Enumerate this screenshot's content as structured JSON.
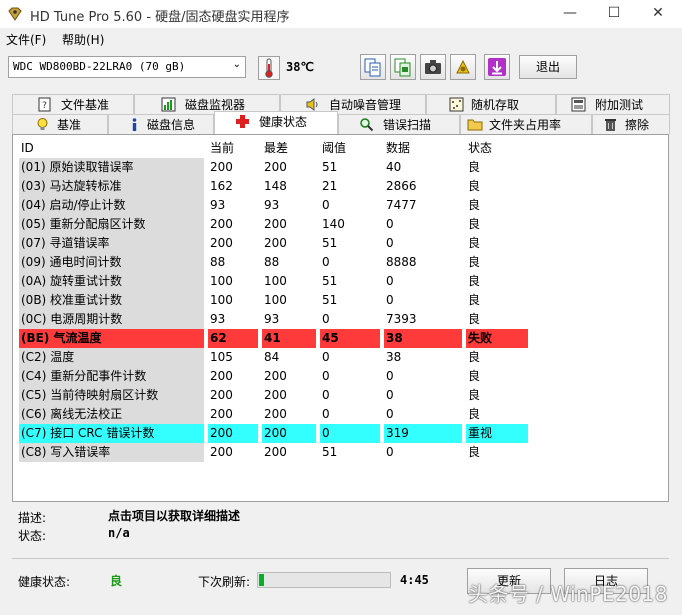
{
  "window": {
    "title": "HD Tune Pro 5.60 - 硬盘/固态硬盘实用程序",
    "minimize": "—",
    "maximize": "☐",
    "close": "✕"
  },
  "menu": {
    "file": "文件(F)",
    "help": "帮助(H)"
  },
  "toolbar": {
    "drive": "WDC WD800BD-22LRA0 (70 gB)",
    "temperature": "38℃",
    "exit": "退出",
    "buttons": [
      "copy-text-icon",
      "copy-screen-icon",
      "camera-icon",
      "options-icon",
      "save-icon"
    ]
  },
  "tabs": {
    "row1": [
      "文件基准",
      "磁盘监视器",
      "自动噪音管理",
      "随机存取",
      "附加测试"
    ],
    "row2": [
      "基准",
      "磁盘信息",
      "健康状态",
      "错误扫描",
      "文件夹占用率",
      "擦除"
    ],
    "active": "健康状态"
  },
  "table": {
    "columns": [
      "ID",
      "当前",
      "最差",
      "阈值",
      "数据",
      "状态"
    ],
    "rows": [
      {
        "id": "(01) 原始读取错误率",
        "current": "200",
        "worst": "200",
        "threshold": "51",
        "data": "40",
        "status": "良",
        "highlight": ""
      },
      {
        "id": "(03) 马达旋转标准",
        "current": "162",
        "worst": "148",
        "threshold": "21",
        "data": "2866",
        "status": "良",
        "highlight": ""
      },
      {
        "id": "(04) 启动/停止计数",
        "current": "93",
        "worst": "93",
        "threshold": "0",
        "data": "7477",
        "status": "良",
        "highlight": ""
      },
      {
        "id": "(05) 重新分配扇区计数",
        "current": "200",
        "worst": "200",
        "threshold": "140",
        "data": "0",
        "status": "良",
        "highlight": ""
      },
      {
        "id": "(07) 寻道错误率",
        "current": "200",
        "worst": "200",
        "threshold": "51",
        "data": "0",
        "status": "良",
        "highlight": ""
      },
      {
        "id": "(09) 通电时间计数",
        "current": "88",
        "worst": "88",
        "threshold": "0",
        "data": "8888",
        "status": "良",
        "highlight": ""
      },
      {
        "id": "(0A) 旋转重试计数",
        "current": "100",
        "worst": "100",
        "threshold": "51",
        "data": "0",
        "status": "良",
        "highlight": ""
      },
      {
        "id": "(0B) 校准重试计数",
        "current": "100",
        "worst": "100",
        "threshold": "51",
        "data": "0",
        "status": "良",
        "highlight": ""
      },
      {
        "id": "(0C) 电源周期计数",
        "current": "93",
        "worst": "93",
        "threshold": "0",
        "data": "7393",
        "status": "良",
        "highlight": ""
      },
      {
        "id": "(BE) 气流温度",
        "current": "62",
        "worst": "41",
        "threshold": "45",
        "data": "38",
        "status": "失败",
        "highlight": "red"
      },
      {
        "id": "(C2) 温度",
        "current": "105",
        "worst": "84",
        "threshold": "0",
        "data": "38",
        "status": "良",
        "highlight": ""
      },
      {
        "id": "(C4) 重新分配事件计数",
        "current": "200",
        "worst": "200",
        "threshold": "0",
        "data": "0",
        "status": "良",
        "highlight": ""
      },
      {
        "id": "(C5) 当前待映射扇区计数",
        "current": "200",
        "worst": "200",
        "threshold": "0",
        "data": "0",
        "status": "良",
        "highlight": ""
      },
      {
        "id": "(C6) 离线无法校正",
        "current": "200",
        "worst": "200",
        "threshold": "0",
        "data": "0",
        "status": "良",
        "highlight": ""
      },
      {
        "id": "(C7) 接口 CRC 错误计数",
        "current": "200",
        "worst": "200",
        "threshold": "0",
        "data": "319",
        "status": "重视",
        "highlight": "cyan"
      },
      {
        "id": "(C8) 写入错误率",
        "current": "200",
        "worst": "200",
        "threshold": "51",
        "data": "0",
        "status": "良",
        "highlight": ""
      }
    ]
  },
  "details": {
    "description_label": "描述:",
    "description_value": "点击项目以获取详细描述",
    "status_label": "状态:",
    "status_value": "n/a"
  },
  "footer": {
    "health_label": "健康状态:",
    "health_value": "良",
    "health_color": "#1a9a1a",
    "refresh_label": "下次刷新:",
    "refresh_progress": 0.04,
    "countdown": "4:45",
    "refresh_button": "更新",
    "log_button": "日志"
  },
  "watermark": "头条号 / WinPE2018"
}
